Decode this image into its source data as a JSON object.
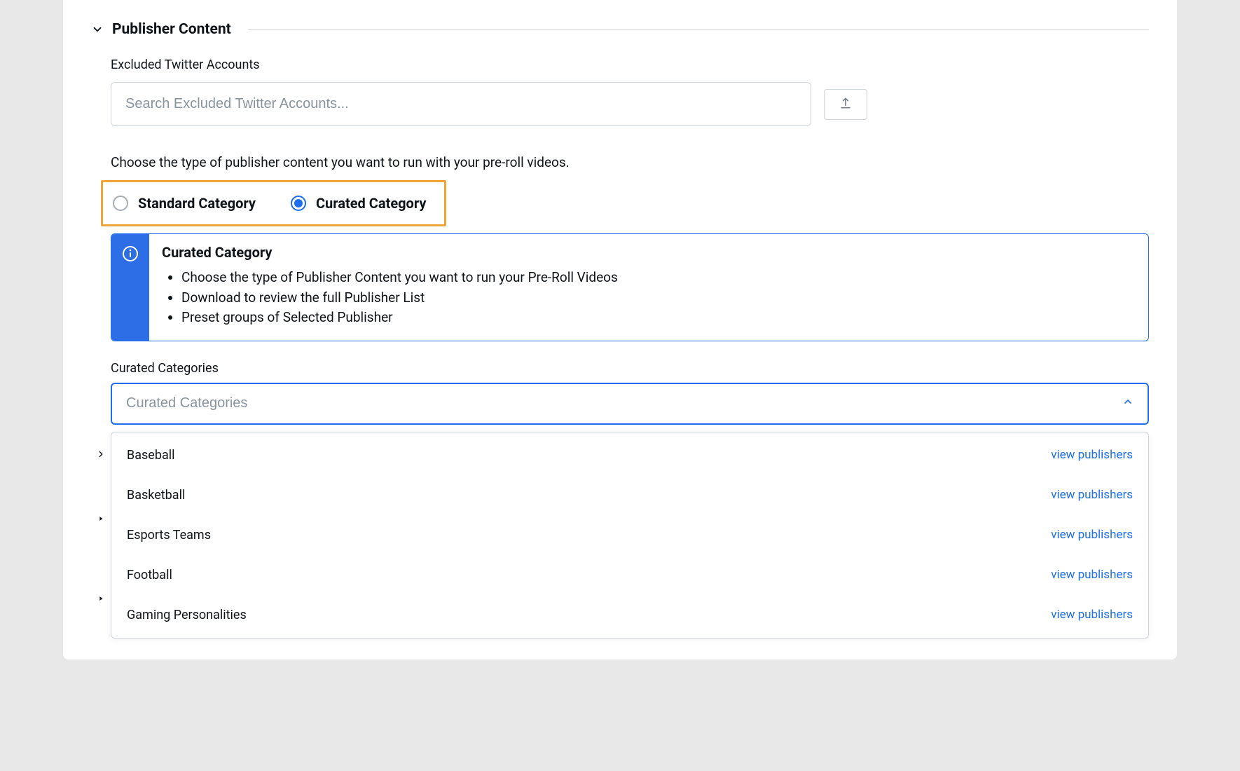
{
  "section": {
    "title": "Publisher Content"
  },
  "excluded": {
    "label": "Excluded Twitter Accounts",
    "placeholder": "Search Excluded Twitter Accounts..."
  },
  "choose_text": "Choose the type of publisher content you want to run with your pre-roll videos.",
  "radio": {
    "standard_label": "Standard Category",
    "curated_label": "Curated Category"
  },
  "info": {
    "title": "Curated Category",
    "bullets": [
      "Choose the type of Publisher Content you want to run your Pre-Roll Videos",
      "Download to review the full Publisher List",
      "Preset groups of Selected Publisher"
    ]
  },
  "curated": {
    "label": "Curated Categories",
    "placeholder": "Curated Categories",
    "view_label": "view publishers",
    "options": [
      {
        "name": "Baseball"
      },
      {
        "name": "Basketball"
      },
      {
        "name": "Esports Teams"
      },
      {
        "name": "Football"
      },
      {
        "name": "Gaming Personalities"
      }
    ]
  }
}
